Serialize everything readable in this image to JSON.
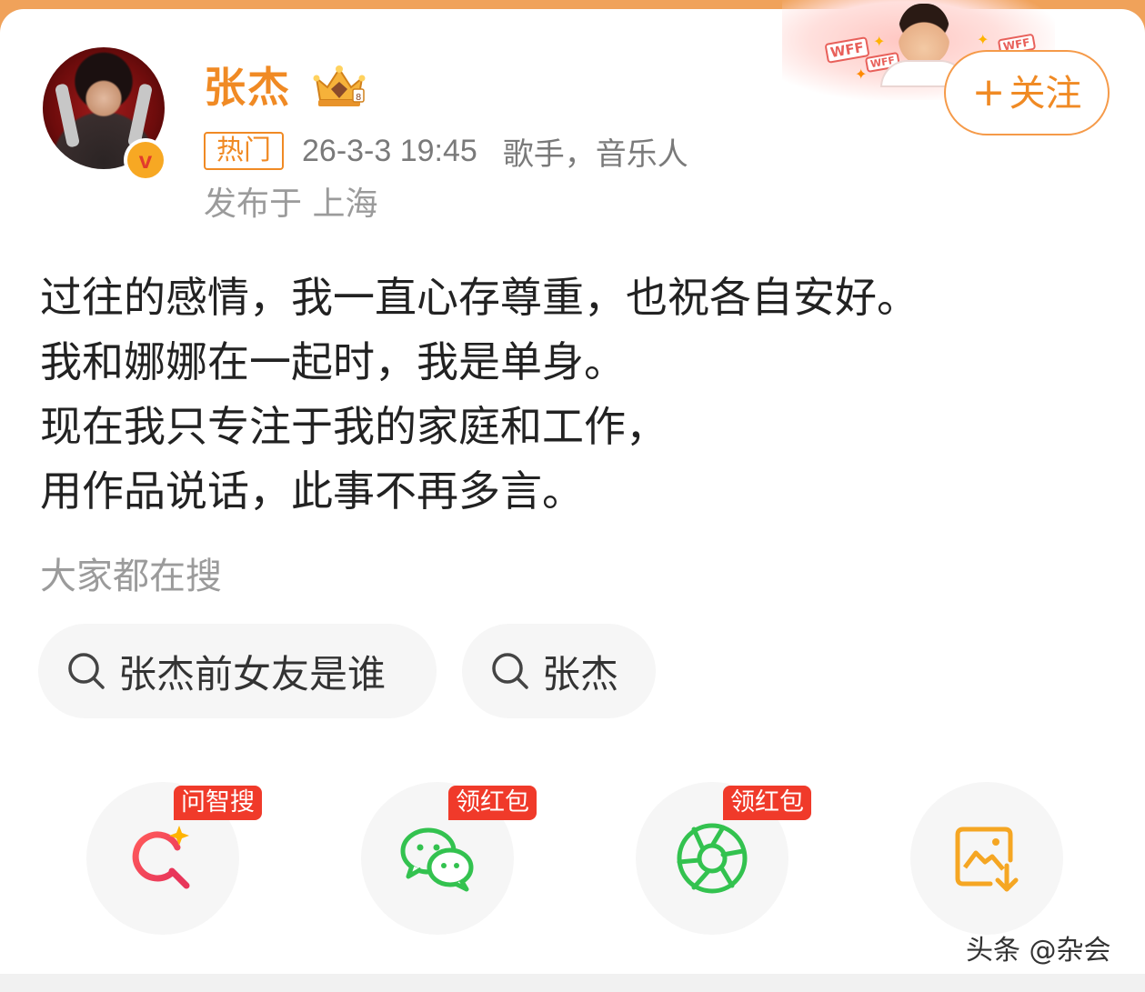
{
  "post": {
    "author_name": "张杰",
    "follow_label": "关注",
    "hot_tag": "热门",
    "time": "26-3-3 19:45",
    "role": "歌手，音乐人",
    "location": "发布于 上海",
    "content_lines": [
      "过往的感情，我一直心存尊重，也祝各自安好。",
      "我和娜娜在一起时，我是单身。",
      "现在我只专注于我的家庭和工作，",
      "用作品说话，此事不再多言。"
    ]
  },
  "search": {
    "title": "大家都在搜",
    "chips": [
      "张杰前女友是谁",
      "张杰"
    ]
  },
  "actions": {
    "badges": [
      "问智搜",
      "领红包",
      "领红包"
    ],
    "icons": [
      "ai-search-icon",
      "wechat-icon",
      "moments-icon",
      "save-image-icon"
    ]
  },
  "decor": {
    "tags": [
      "WFF",
      "WFF",
      "WFF"
    ]
  },
  "watermark": "头条 @杂会",
  "colors": {
    "accent": "#f08a24",
    "badge": "#f03a2a",
    "wechat": "#33c24f",
    "save": "#f5a623"
  }
}
